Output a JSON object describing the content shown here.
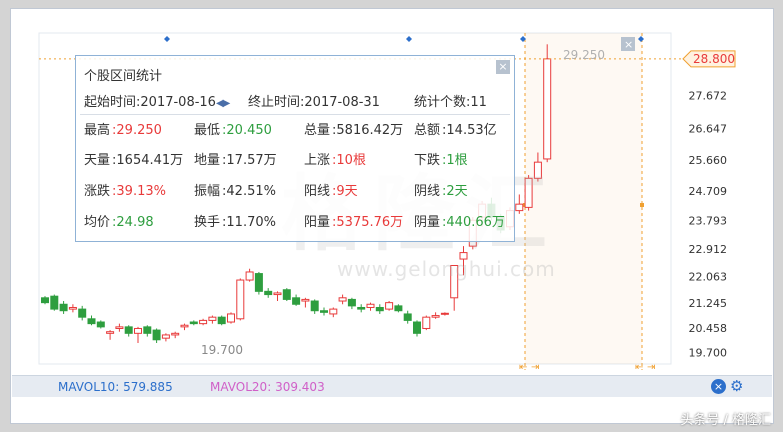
{
  "stats": {
    "title": "个股区间统计",
    "start_label": "起始时间",
    "start_value": ":2017-08-16",
    "end_label": "终止时间",
    "end_value": ":2017-08-31",
    "count_label": "统计个数",
    "count_value": ":11",
    "close_symbol": "×",
    "rows": [
      [
        {
          "label": "最高",
          "value": ":29.250",
          "color": "red"
        },
        {
          "label": "最低",
          "value": ":20.450",
          "color": "green"
        },
        {
          "label": "总量",
          "value": ":5816.42万",
          "color": ""
        },
        {
          "label": "总额",
          "value": ":14.53亿",
          "color": ""
        }
      ],
      [
        {
          "label": "天量",
          "value": ":1654.41万",
          "color": ""
        },
        {
          "label": "地量",
          "value": ":17.57万",
          "color": ""
        },
        {
          "label": "上涨",
          "value": ":10根",
          "color": "red"
        },
        {
          "label": "下跌",
          "value": ":1根",
          "color": "green"
        }
      ],
      [
        {
          "label": "涨跌",
          "value": ":39.13%",
          "color": "red"
        },
        {
          "label": "振幅",
          "value": ":42.51%",
          "color": ""
        },
        {
          "label": "阳线",
          "value": ":9天",
          "color": "red"
        },
        {
          "label": "阴线",
          "value": ":2天",
          "color": "green"
        }
      ],
      [
        {
          "label": "均价",
          "value": ":24.98",
          "color": "green"
        },
        {
          "label": "换手",
          "value": ":11.70%",
          "color": ""
        },
        {
          "label": "阳量",
          "value": ":5375.76万",
          "color": "red"
        },
        {
          "label": "阴量",
          "value": ":440.66万",
          "color": "green"
        }
      ]
    ]
  },
  "price_axis": [
    "27.672",
    "26.647",
    "25.660",
    "24.709",
    "23.793",
    "22.912",
    "22.063",
    "21.245",
    "20.458",
    "19.700"
  ],
  "current_price_tag": "28.800",
  "high_marker": "29.250",
  "low_marker": "19.700",
  "mavol10": {
    "label": "MAVOL10:",
    "value": "579.885"
  },
  "mavol20": {
    "label": "MAVOL20:",
    "value": "309.403"
  },
  "watermark": {
    "logo": "格隆汇",
    "url": "www.gelonghui.com"
  },
  "credit": "头条号 / 格隆汇",
  "colors": {
    "up": "#e83a3a",
    "down": "#2e9e3f",
    "accent": "#2c6fcb",
    "range_line": "#f0a030"
  },
  "icons": [
    "close-icon",
    "arrows-icon",
    "gear-icon",
    "diamond-icon"
  ],
  "candles": [
    {
      "o": 21.4,
      "h": 21.45,
      "l": 21.2,
      "c": 21.25
    },
    {
      "o": 21.45,
      "h": 21.5,
      "l": 21.0,
      "c": 21.05
    },
    {
      "o": 21.2,
      "h": 21.3,
      "l": 20.9,
      "c": 21.0
    },
    {
      "o": 21.05,
      "h": 21.2,
      "l": 20.95,
      "c": 21.1
    },
    {
      "o": 21.05,
      "h": 21.15,
      "l": 20.7,
      "c": 20.8
    },
    {
      "o": 20.75,
      "h": 20.85,
      "l": 20.55,
      "c": 20.6
    },
    {
      "o": 20.65,
      "h": 20.7,
      "l": 20.45,
      "c": 20.5
    },
    {
      "o": 20.3,
      "h": 20.4,
      "l": 20.1,
      "c": 20.35
    },
    {
      "o": 20.45,
      "h": 20.6,
      "l": 20.35,
      "c": 20.5
    },
    {
      "o": 20.5,
      "h": 20.55,
      "l": 20.2,
      "c": 20.3
    },
    {
      "o": 20.3,
      "h": 20.5,
      "l": 20.0,
      "c": 20.45
    },
    {
      "o": 20.5,
      "h": 20.55,
      "l": 20.2,
      "c": 20.3
    },
    {
      "o": 20.4,
      "h": 20.45,
      "l": 20.0,
      "c": 20.1
    },
    {
      "o": 20.15,
      "h": 20.3,
      "l": 20.05,
      "c": 20.25
    },
    {
      "o": 20.25,
      "h": 20.35,
      "l": 20.15,
      "c": 20.3
    },
    {
      "o": 20.5,
      "h": 20.6,
      "l": 20.4,
      "c": 20.55
    },
    {
      "o": 20.65,
      "h": 20.7,
      "l": 20.55,
      "c": 20.6
    },
    {
      "o": 20.6,
      "h": 20.75,
      "l": 20.55,
      "c": 20.7
    },
    {
      "o": 20.7,
      "h": 20.85,
      "l": 20.6,
      "c": 20.8
    },
    {
      "o": 20.8,
      "h": 20.85,
      "l": 20.55,
      "c": 20.6
    },
    {
      "o": 20.65,
      "h": 20.95,
      "l": 20.6,
      "c": 20.9
    },
    {
      "o": 20.75,
      "h": 22.0,
      "l": 20.7,
      "c": 21.95
    },
    {
      "o": 21.95,
      "h": 22.3,
      "l": 21.9,
      "c": 22.2
    },
    {
      "o": 22.15,
      "h": 22.2,
      "l": 21.5,
      "c": 21.6
    },
    {
      "o": 21.6,
      "h": 21.7,
      "l": 21.4,
      "c": 21.5
    },
    {
      "o": 21.5,
      "h": 21.6,
      "l": 21.3,
      "c": 21.55
    },
    {
      "o": 21.65,
      "h": 21.7,
      "l": 21.3,
      "c": 21.35
    },
    {
      "o": 21.4,
      "h": 21.5,
      "l": 21.15,
      "c": 21.2
    },
    {
      "o": 21.3,
      "h": 21.4,
      "l": 21.1,
      "c": 21.35
    },
    {
      "o": 21.3,
      "h": 21.35,
      "l": 20.9,
      "c": 21.0
    },
    {
      "o": 21.0,
      "h": 21.1,
      "l": 20.85,
      "c": 20.95
    },
    {
      "o": 20.9,
      "h": 21.1,
      "l": 20.8,
      "c": 21.05
    },
    {
      "o": 21.3,
      "h": 21.5,
      "l": 21.2,
      "c": 21.4
    },
    {
      "o": 21.35,
      "h": 21.4,
      "l": 21.05,
      "c": 21.15
    },
    {
      "o": 21.1,
      "h": 21.2,
      "l": 20.95,
      "c": 21.05
    },
    {
      "o": 21.1,
      "h": 21.25,
      "l": 21.0,
      "c": 21.2
    },
    {
      "o": 21.1,
      "h": 21.2,
      "l": 20.9,
      "c": 21.0
    },
    {
      "o": 21.05,
      "h": 21.3,
      "l": 21.0,
      "c": 21.25
    },
    {
      "o": 21.15,
      "h": 21.2,
      "l": 20.95,
      "c": 21.0
    },
    {
      "o": 20.9,
      "h": 21.0,
      "l": 20.6,
      "c": 20.7
    },
    {
      "o": 20.65,
      "h": 20.7,
      "l": 20.2,
      "c": 20.3
    },
    {
      "o": 20.45,
      "h": 20.85,
      "l": 20.4,
      "c": 20.8
    },
    {
      "o": 20.8,
      "h": 20.95,
      "l": 20.75,
      "c": 20.85
    },
    {
      "o": 20.9,
      "h": 20.95,
      "l": 20.85,
      "c": 20.92
    },
    {
      "o": 21.4,
      "h": 22.2,
      "l": 21.0,
      "c": 22.4
    },
    {
      "o": 22.6,
      "h": 23.0,
      "l": 22.1,
      "c": 22.8
    },
    {
      "o": 23.0,
      "h": 23.9,
      "l": 22.9,
      "c": 23.8
    },
    {
      "o": 23.9,
      "h": 24.4,
      "l": 23.6,
      "c": 24.3
    },
    {
      "o": 24.3,
      "h": 24.5,
      "l": 23.8,
      "c": 23.9
    },
    {
      "o": 23.9,
      "h": 24.0,
      "l": 23.4,
      "c": 23.5
    },
    {
      "o": 23.6,
      "h": 24.2,
      "l": 23.5,
      "c": 24.1
    },
    {
      "o": 24.1,
      "h": 24.6,
      "l": 24.0,
      "c": 24.3
    },
    {
      "o": 24.2,
      "h": 25.2,
      "l": 24.1,
      "c": 25.1
    },
    {
      "o": 25.1,
      "h": 25.9,
      "l": 25.0,
      "c": 25.6
    },
    {
      "o": 25.7,
      "h": 29.25,
      "l": 25.6,
      "c": 28.8
    }
  ]
}
